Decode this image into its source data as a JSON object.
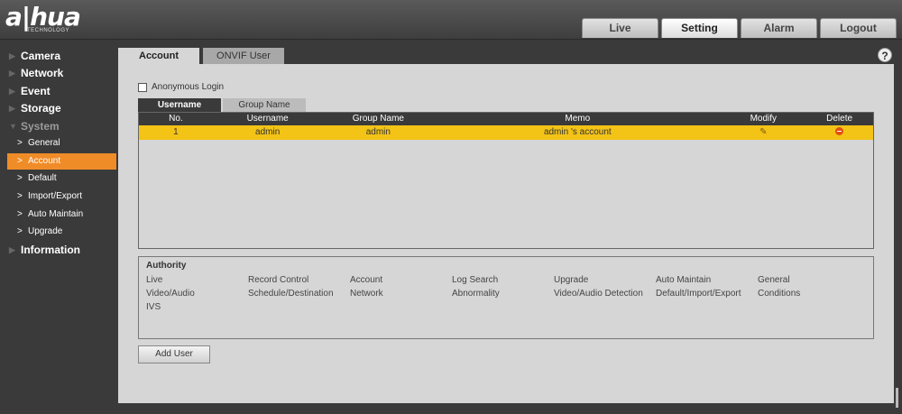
{
  "brand": {
    "logo": "a|hua",
    "tagline": "TECHNOLOGY"
  },
  "topnav": [
    {
      "label": "Live",
      "active": false
    },
    {
      "label": "Setting",
      "active": true
    },
    {
      "label": "Alarm",
      "active": false
    },
    {
      "label": "Logout",
      "active": false
    }
  ],
  "sidebar": {
    "categories": [
      "Camera",
      "Network",
      "Event",
      "Storage",
      "System",
      "Information"
    ],
    "system_items": [
      "General",
      "Account",
      "Default",
      "Import/Export",
      "Auto Maintain",
      "Upgrade"
    ],
    "active_item": "Account"
  },
  "page_tabs": [
    "Account",
    "ONVIF User"
  ],
  "anonymous_login_label": "Anonymous Login",
  "sub_tabs": [
    "Username",
    "Group Name"
  ],
  "table": {
    "headers": [
      "No.",
      "Username",
      "Group Name",
      "Memo",
      "Modify",
      "Delete"
    ],
    "rows": [
      {
        "no": "1",
        "username": "admin",
        "group": "admin",
        "memo": "admin 's account"
      }
    ]
  },
  "authority": {
    "title": "Authority",
    "items": [
      "Live",
      "Record Control",
      "Account",
      "Log Search",
      "Upgrade",
      "Auto Maintain",
      "General",
      "Video/Audio",
      "Schedule/Destination",
      "Network",
      "Abnormality",
      "Video/Audio Detection",
      "Default/Import/Export",
      "Conditions",
      "IVS"
    ]
  },
  "add_user_label": "Add User",
  "help_icon": "?",
  "colors": {
    "accent": "#f08c28",
    "row_highlight": "#f3c316",
    "header_dark": "#3a3a3a"
  },
  "icons": {
    "modify": "pencil-icon",
    "delete": "minus-circle-icon"
  }
}
